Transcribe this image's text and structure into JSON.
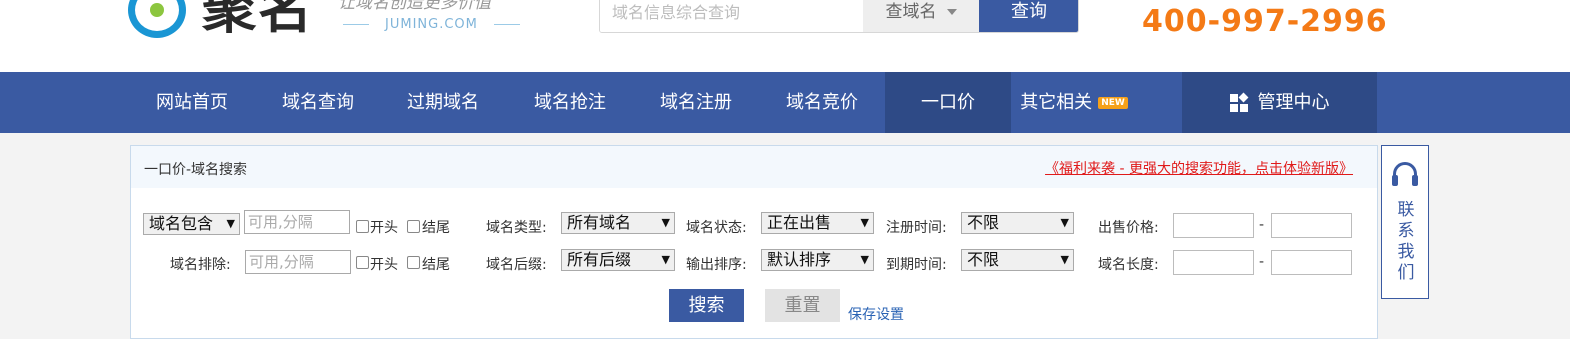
{
  "header": {
    "logo_text": "聚名",
    "slogan": "让域名创造更多价值",
    "slogan_en": "JUMING.COM",
    "search": {
      "placeholder": "域名信息综合查询",
      "type_label": "查域名",
      "button_label": "查询"
    },
    "hotline": "400-997-2996"
  },
  "nav": {
    "items": [
      {
        "label": "网站首页"
      },
      {
        "label": "域名查询"
      },
      {
        "label": "过期域名"
      },
      {
        "label": "域名抢注"
      },
      {
        "label": "域名注册"
      },
      {
        "label": "域名竞价"
      },
      {
        "label": "一口价"
      },
      {
        "label": "其它相关",
        "badge": "NEW"
      }
    ],
    "admin_label": "管理中心"
  },
  "panel": {
    "title": "一口价-域名搜索",
    "promo_link": "《福利来袭 - 更强大的搜索功能，点击体验新版》",
    "row1": {
      "contains_select": "域名包含",
      "contains_placeholder": "可用,分隔",
      "chk_start": "开头",
      "chk_end": "结尾",
      "type_label": "域名类型:",
      "type_value": "所有域名",
      "status_label": "域名状态:",
      "status_value": "正在出售",
      "reg_time_label": "注册时间:",
      "reg_time_value": "不限",
      "price_label": "出售价格:",
      "price_sep": "-"
    },
    "row2": {
      "exclude_label": "域名排除:",
      "exclude_placeholder": "可用,分隔",
      "chk_start": "开头",
      "chk_end": "结尾",
      "suffix_label": "域名后缀:",
      "suffix_value": "所有后缀",
      "sort_label": "输出排序:",
      "sort_value": "默认排序",
      "expire_label": "到期时间:",
      "expire_value": "不限",
      "length_label": "域名长度:",
      "length_sep": "-"
    },
    "search_button": "搜索",
    "reset_button": "重置",
    "save_link": "保存设置"
  },
  "contact": {
    "label": "联系我们"
  },
  "colors": {
    "brand_blue": "#3a5aa2",
    "hotline_orange": "#f47a16",
    "promo_red": "#e01a1a"
  }
}
